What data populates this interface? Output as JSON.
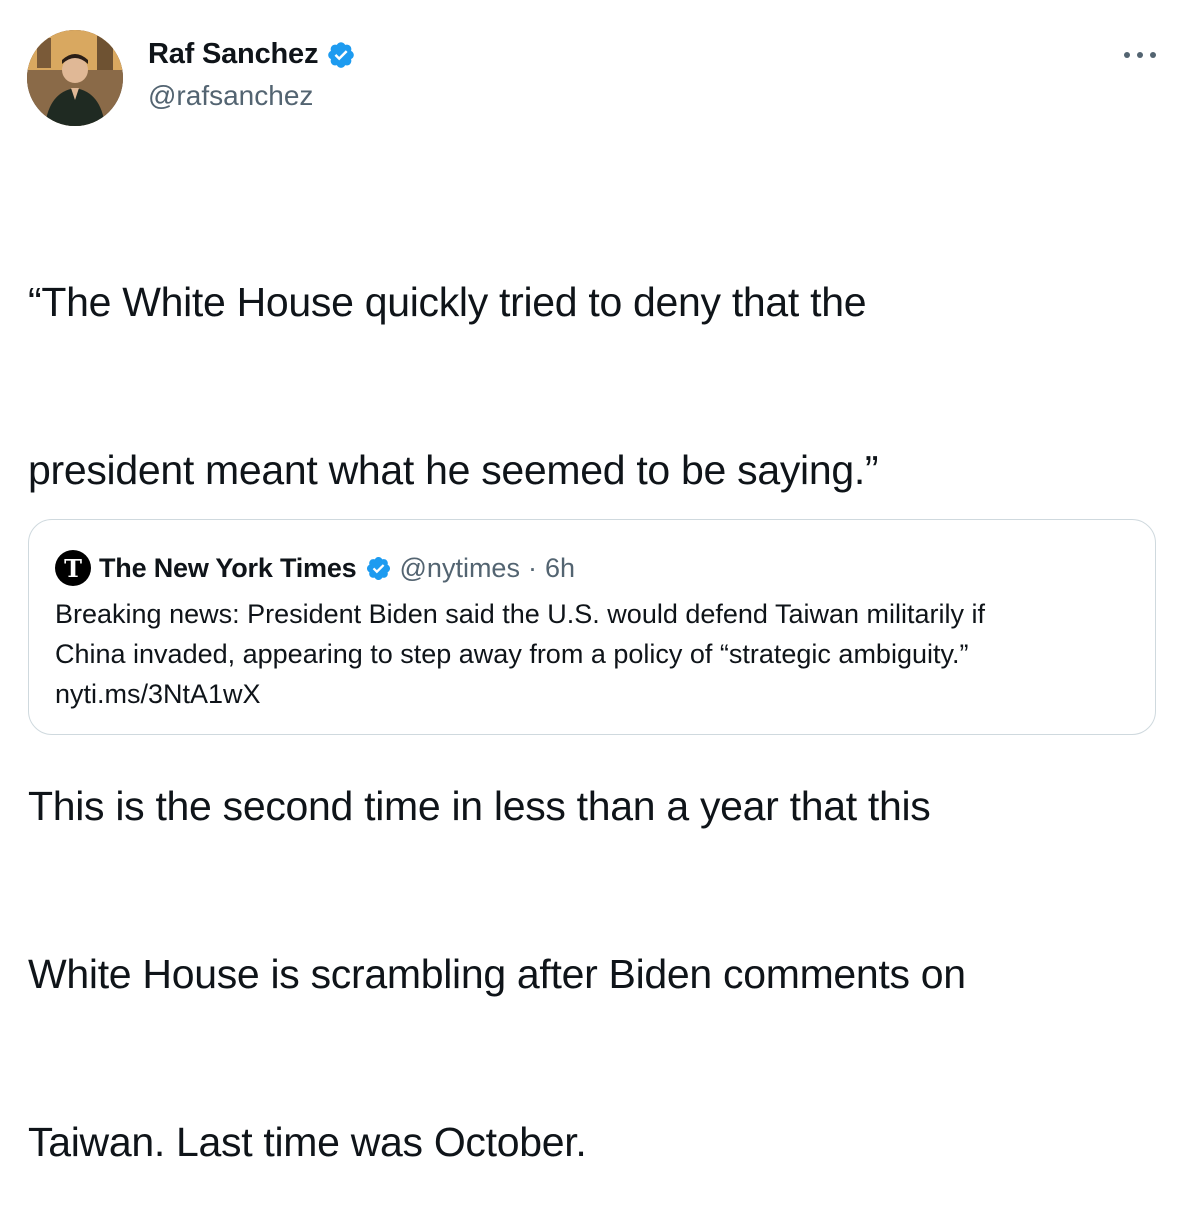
{
  "author": {
    "display_name": "Raf Sanchez",
    "handle": "@rafsanchez"
  },
  "tweet": {
    "text_lines": [
      "“The White House quickly tried to deny that the",
      "president meant what he seemed to be saying.”",
      "",
      "This is the second time in less than a year that this",
      "White House is scrambling after Biden comments on",
      "Taiwan. Last time was October."
    ]
  },
  "quoted_tweet": {
    "display_name": "The New York Times",
    "handle": "@nytimes",
    "separator": "·",
    "time": "6h",
    "body_lines": [
      "Breaking news: President Biden said the U.S. would defend Taiwan militarily if",
      "China invaded, appearing to step away from a policy of “strategic ambiguity.”",
      "nyti.ms/3NtA1wX"
    ]
  },
  "colors": {
    "verified": "#1d9bf0",
    "secondary_text": "#536471",
    "border": "#cfd9de"
  }
}
